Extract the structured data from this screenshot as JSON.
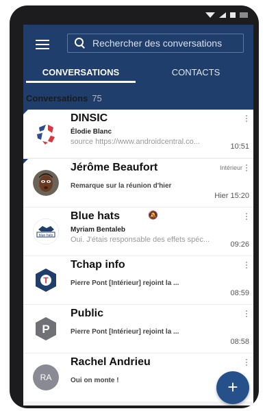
{
  "search": {
    "placeholder": "Rechercher des conversations"
  },
  "tabs": [
    {
      "label": "CONVERSATIONS"
    },
    {
      "label": "CONTACTS"
    }
  ],
  "section": {
    "title": "Conversations",
    "count": "75"
  },
  "rooms": [
    {
      "name": "DINSIC",
      "sender": "Élodie Blanc",
      "preview": "source https://www.androidcentral.co...",
      "time": "10:51",
      "tag": ""
    },
    {
      "name": "Jérôme Beaufort",
      "sender": "",
      "preview": "Remarque sur la réunion d'hier",
      "time": "Hier 15:20",
      "tag": "Intérieur"
    },
    {
      "name": "Blue hats",
      "sender": "Myriam Bentaleb",
      "preview": "Oui. J'étais responsable des effets spéc...",
      "time": "09:26",
      "tag": "",
      "avatar_text": "blue·hats"
    },
    {
      "name": "Tchap info",
      "sender": "",
      "preview": "Pierre Pont   [Intérieur] rejoint la ...",
      "time": "08:59",
      "tag": "",
      "avatar_text": "T"
    },
    {
      "name": "Public",
      "sender": "",
      "preview": "Pierre Pont   [Intérieur] rejoint la ...",
      "time": "08:58",
      "tag": "",
      "avatar_text": "P"
    },
    {
      "name": "Rachel Andrieu",
      "sender": "",
      "preview": "Oui on monte !",
      "time": "",
      "tag": "",
      "avatar_text": "RA"
    }
  ],
  "fab": {
    "label": "+"
  },
  "colors": {
    "header": "#1f3e6b",
    "accent": "#26508a",
    "tchap": "#1f3e6b",
    "danger": "#d9363e"
  },
  "icons": [
    "menu-icon",
    "search-icon",
    "more-vert-icon",
    "bell-off-icon",
    "plus-icon"
  ]
}
